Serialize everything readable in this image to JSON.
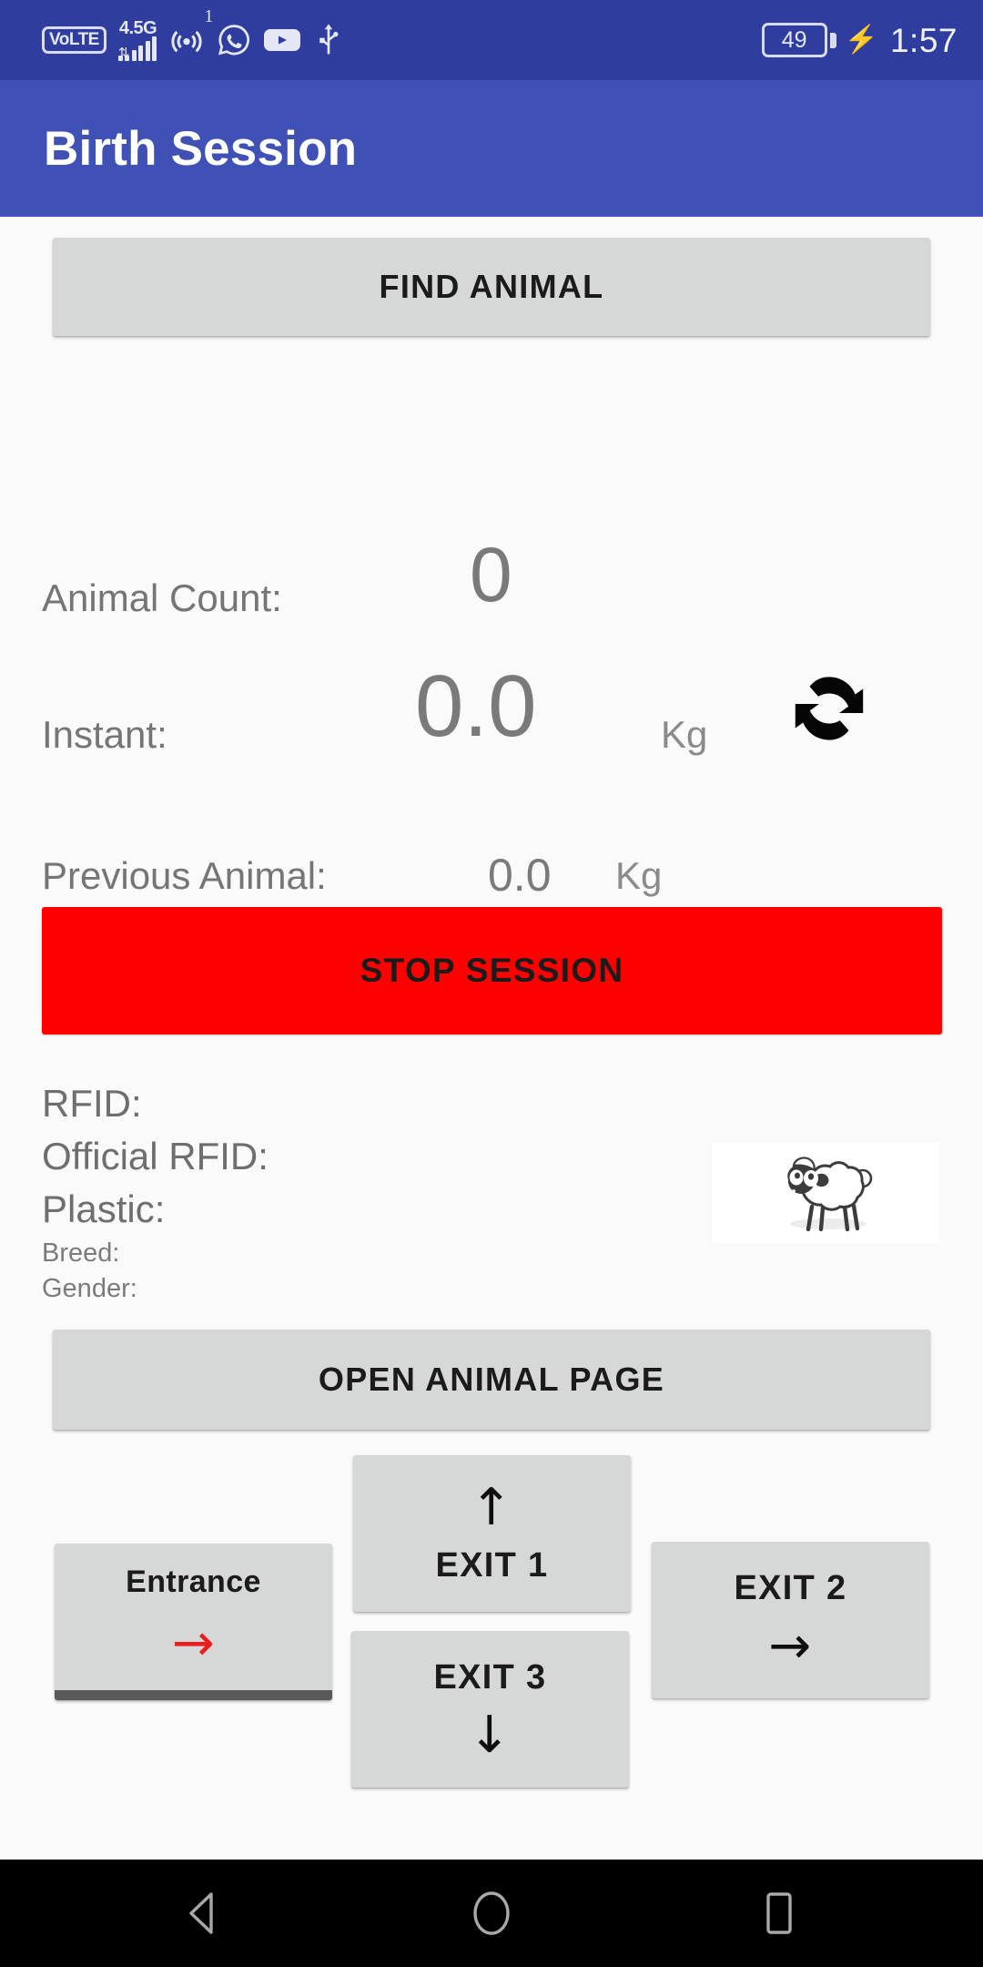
{
  "status_bar": {
    "volte_label": "VoLTE",
    "network_label": "4.5G",
    "notification_badge": "1",
    "battery_level": "49",
    "clock": "1:57",
    "icons": [
      "volte-badge",
      "signal-bars-icon",
      "hotspot-icon",
      "whatsapp-icon",
      "youtube-icon",
      "usb-icon",
      "battery-icon",
      "charging-bolt-icon"
    ],
    "colors": {
      "background": "#2F3E9E",
      "foreground": "#E4E7F5"
    }
  },
  "app_bar": {
    "title": "Birth Session",
    "color": "#3F51B5"
  },
  "main": {
    "find_animal_label": "FIND ANIMAL",
    "metrics": [
      {
        "label": "Animal Count:",
        "value": "0",
        "unit": ""
      },
      {
        "label": "Instant:",
        "value": "0.0",
        "unit": "Kg"
      },
      {
        "label": "Previous Animal:",
        "value": "0.0",
        "unit": "Kg"
      }
    ],
    "refresh_icon": "refresh-icon",
    "stop_session_label": "STOP SESSION",
    "stop_session_color": "#FF0000",
    "info_fields": [
      {
        "label": "RFID:",
        "value": "",
        "size": "big"
      },
      {
        "label": "Official RFID:",
        "value": "",
        "size": "big"
      },
      {
        "label": "Plastic:",
        "value": "",
        "size": "big"
      },
      {
        "label": "Breed:",
        "value": "",
        "size": "small"
      },
      {
        "label": "Gender:",
        "value": "",
        "size": "small"
      }
    ],
    "animal_thumbnail": "sheep-image",
    "open_animal_page_label": "OPEN ANIMAL PAGE",
    "direction_buttons": {
      "entrance": {
        "label": "Entrance",
        "arrow": "→",
        "arrow_color": "#E81F1F"
      },
      "exit1": {
        "label": "EXIT 1",
        "arrow": "↑",
        "arrow_color": "#0D0D0D"
      },
      "exit2": {
        "label": "EXIT 2",
        "arrow": "→",
        "arrow_color": "#0D0D0D"
      },
      "exit3": {
        "label": "EXIT 3",
        "arrow": "↓",
        "arrow_color": "#0D0D0D"
      }
    }
  },
  "nav_bar": {
    "back": "back-triangle-icon",
    "home": "home-circle-icon",
    "recents": "recents-square-icon"
  }
}
